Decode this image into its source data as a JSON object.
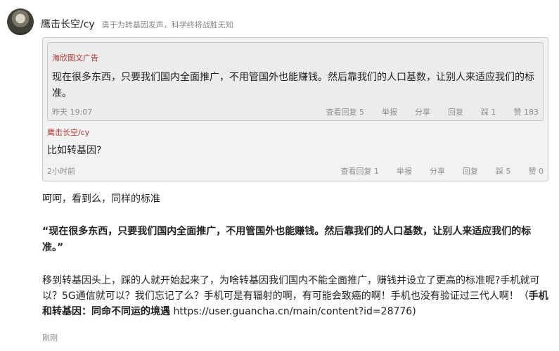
{
  "author": {
    "name": "鹰击长空/cy",
    "signature": "勇于为转基因发声，科学终将战胜无知"
  },
  "quote_inner": {
    "user": "海欣图文广告",
    "text": "现在很多东西，只要我们国内全面推广，不用管国外也能赚钱。然后靠我们的人口基数，让别人来适应我们的标准。",
    "time": "昨天 19:07",
    "view_replies": "查看回复 5",
    "report": "举报",
    "share": "分享",
    "reply": "回复",
    "dislike": "踩 1",
    "like": "赞 183"
  },
  "quote_outer": {
    "user": "鹰击长空/cy",
    "text": "比如转基因?",
    "time": "2小时前",
    "view_replies": "查看回复 1",
    "report": "举报",
    "share": "分享",
    "reply": "回复",
    "dislike": "踩 5",
    "like": "赞 0"
  },
  "post": {
    "line1": "呵呵，看到么，同样的标准",
    "bold_quote": "“现在很多东西，只要我们国内全面推广，不用管国外也能赚钱。然后靠我们的人口基数，让别人来适应我们的标准。”",
    "para_text": "移到转基因头上，踩的人就开始起来了，为啥转基因我们国内不能全面推广，赚钱并设立了更高的标准呢?手机就可以？5G通信就可以？我们忘记了么？手机可是有辐射的啊，有可能会致癌的啊！手机也没有验证过三代人啊！（",
    "link_title": "手机和转基因：同命不同运的境遇",
    "link_url": "https://user.guancha.cn/main/content?id=28776)",
    "time": "刚刚"
  }
}
